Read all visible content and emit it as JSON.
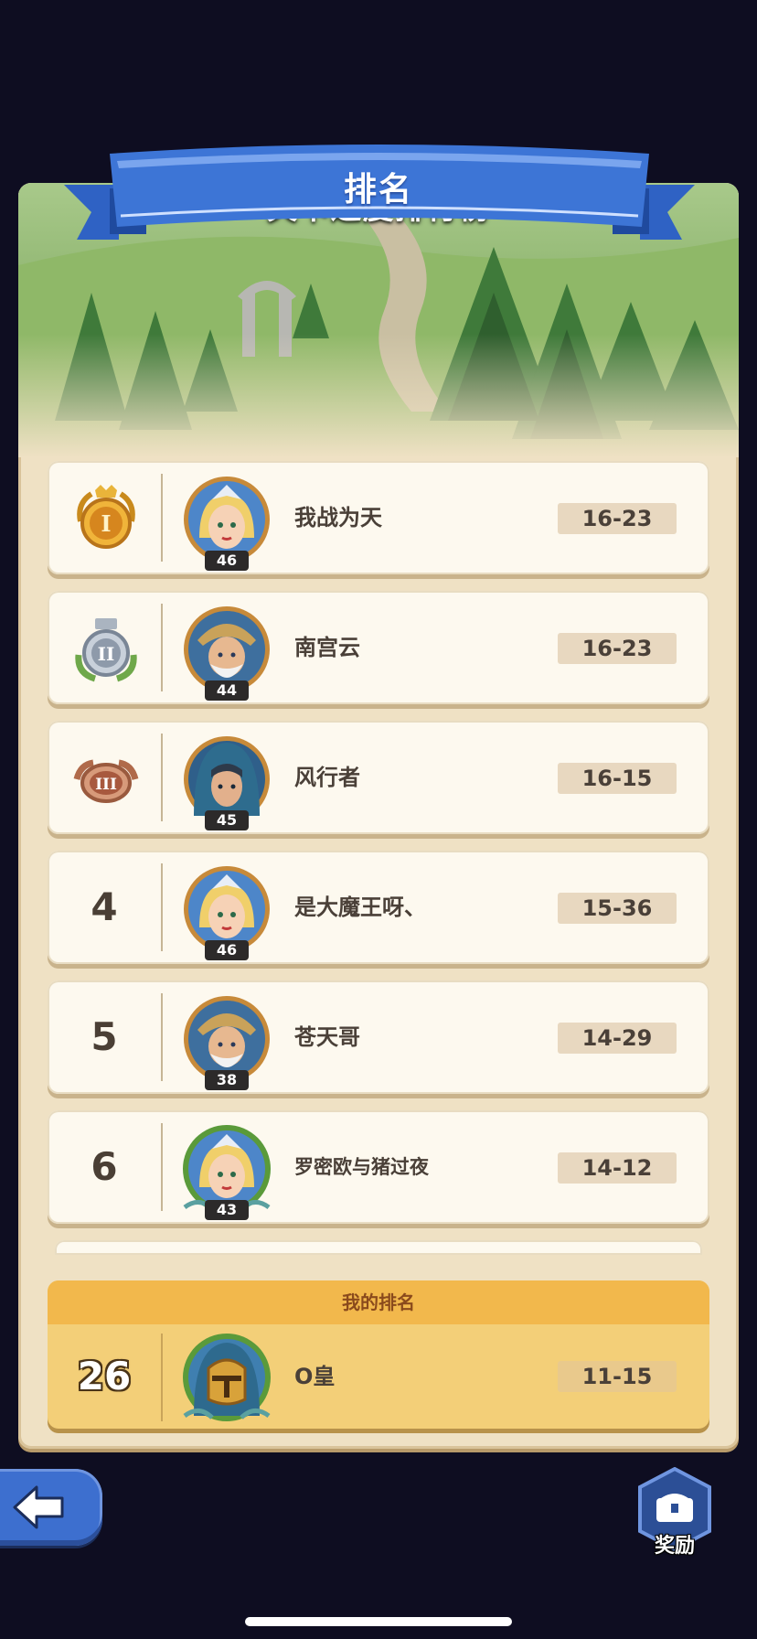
{
  "header": {
    "title": "排名"
  },
  "scene": {
    "title": "关卡进度排行榜"
  },
  "leaderboard": {
    "rows": [
      {
        "rank": "1",
        "medal": "gold-medal-icon",
        "medal_numeral": "I",
        "name": "我战为天",
        "level": "46",
        "score": "16-23",
        "avatar": "blonde-heroine-avatar"
      },
      {
        "rank": "2",
        "medal": "silver-medal-icon",
        "medal_numeral": "II",
        "name": "南宫云",
        "level": "44",
        "score": "16-23",
        "avatar": "old-warrior-avatar"
      },
      {
        "rank": "3",
        "medal": "bronze-medal-icon",
        "medal_numeral": "III",
        "name": "风行者",
        "level": "45",
        "score": "16-15",
        "avatar": "hooded-ranger-avatar"
      },
      {
        "rank": "4",
        "name": "是大魔王呀、",
        "level": "46",
        "score": "15-36",
        "avatar": "blonde-heroine-avatar"
      },
      {
        "rank": "5",
        "name": "苍天哥",
        "level": "38",
        "score": "14-29",
        "avatar": "old-warrior-avatar"
      },
      {
        "rank": "6",
        "name": "罗密欧与猪过夜",
        "level": "43",
        "score": "14-12",
        "avatar": "blonde-heroine-avatar"
      }
    ]
  },
  "my_rank": {
    "header": "我的排名",
    "rank": "26",
    "name": "O皇",
    "score": "11-15",
    "avatar": "golden-helmet-knight-avatar"
  },
  "buttons": {
    "back_icon": "arrow-left-icon",
    "reward_label": "奖励",
    "reward_icon": "treasure-chest-icon"
  },
  "colors": {
    "background": "#0e0d21",
    "panel": "#efe1c4",
    "ribbon": "#3d75d6",
    "row": "#fdf9ef",
    "my_rank": "#f3cf78"
  }
}
